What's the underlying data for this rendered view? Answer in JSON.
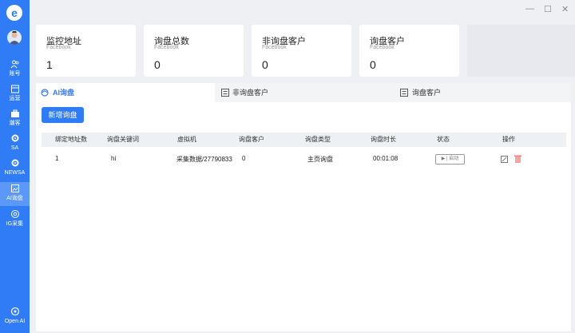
{
  "sidebar": {
    "logo_letter": "e",
    "items": [
      {
        "label": "账号",
        "icon": "users-icon"
      },
      {
        "label": "运营",
        "icon": "calendar-icon"
      },
      {
        "label": "潮客",
        "icon": "briefcase-icon"
      },
      {
        "label": "SA",
        "icon": "gear-icon"
      },
      {
        "label": "NEWSA",
        "icon": "gear-icon"
      },
      {
        "label": "AI询盘",
        "icon": "image-icon"
      },
      {
        "label": "IG采集",
        "icon": "instagram-icon"
      }
    ],
    "bottom_item": {
      "label": "Open AI",
      "icon": "openai-icon"
    }
  },
  "stats": [
    {
      "title": "监控地址",
      "subtitle": "Facebook",
      "value": "1"
    },
    {
      "title": "询盘总数",
      "subtitle": "Facebook",
      "value": "0"
    },
    {
      "title": "非询盘客户",
      "subtitle": "Facebook",
      "value": "0"
    },
    {
      "title": "询盘客户",
      "subtitle": "Facebook",
      "value": "0"
    }
  ],
  "tabs": [
    {
      "label": "AI询盘",
      "icon": "ai-icon",
      "active": true
    },
    {
      "label": "非询盘客户",
      "icon": "list-icon",
      "active": false
    },
    {
      "label": "询盘客户",
      "icon": "list-icon",
      "active": false
    }
  ],
  "actions": {
    "add_label": "新增询盘"
  },
  "table": {
    "columns": [
      "绑定地址数",
      "询盘关键词",
      "虚拟机",
      "询盘客户",
      "询盘类型",
      "询盘时长",
      "状态",
      "操作"
    ],
    "rows": [
      {
        "bound_count": "1",
        "keyword": "hi",
        "vm": "采集数据/27790833",
        "customers": "0",
        "type": "主页询盘",
        "duration": "00:01:08",
        "status_label": "▶ | 启动"
      }
    ]
  },
  "colors": {
    "accent": "#2f7cf6",
    "background": "#eef0f4",
    "delete": "#f08080"
  }
}
